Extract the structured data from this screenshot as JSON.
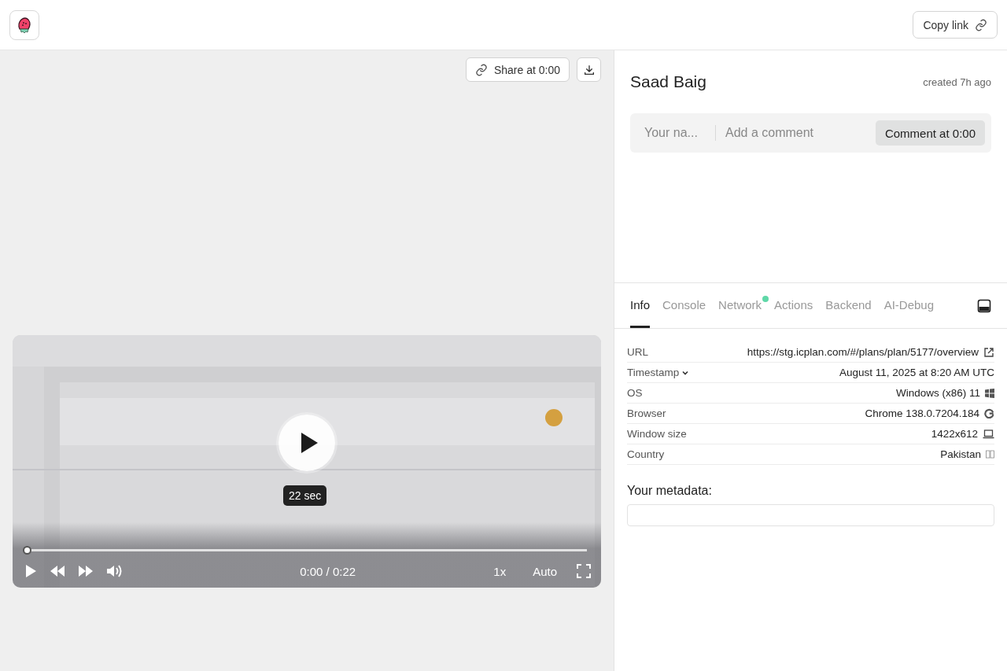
{
  "header": {
    "copy_link": "Copy link"
  },
  "toolbar": {
    "share": "Share at 0:00"
  },
  "player": {
    "duration_badge": "22 sec",
    "time": "0:00 / 0:22",
    "speed": "1x",
    "quality": "Auto",
    "progress": {
      "level": 0
    }
  },
  "session": {
    "user": "Saad Baig",
    "created": "created 7h ago"
  },
  "comment": {
    "name_placeholder": "Your na...",
    "comment_placeholder": "Add a comment",
    "button": "Comment at 0:00"
  },
  "tabs": [
    {
      "label": "Info",
      "selected": true,
      "activity": false
    },
    {
      "label": "Console",
      "selected": false,
      "activity": false
    },
    {
      "label": "Network",
      "selected": false,
      "activity": true
    },
    {
      "label": "Actions",
      "selected": false,
      "activity": false
    },
    {
      "label": "Backend",
      "selected": false,
      "activity": false
    },
    {
      "label": "AI-Debug",
      "selected": false,
      "activity": false
    }
  ],
  "info": [
    {
      "label": "URL",
      "value": "https://stg.icplan.com/#/plans/plan/5177/overview",
      "kind": "link",
      "dropdown": false
    },
    {
      "label": "Timestamp",
      "value": "August 11, 2025 at 8:20 AM UTC",
      "kind": "plain",
      "dropdown": true
    },
    {
      "label": "OS",
      "value": "Windows (x86) 11",
      "kind": "os",
      "dropdown": false
    },
    {
      "label": "Browser",
      "value": "Chrome 138.0.7204.184",
      "kind": "browser",
      "dropdown": false
    },
    {
      "label": "Window size",
      "value": "1422x612",
      "kind": "screen",
      "dropdown": false
    },
    {
      "label": "Country",
      "value": "Pakistan",
      "kind": "flag",
      "dropdown": false
    }
  ],
  "metadata": {
    "label": "Your metadata:"
  }
}
